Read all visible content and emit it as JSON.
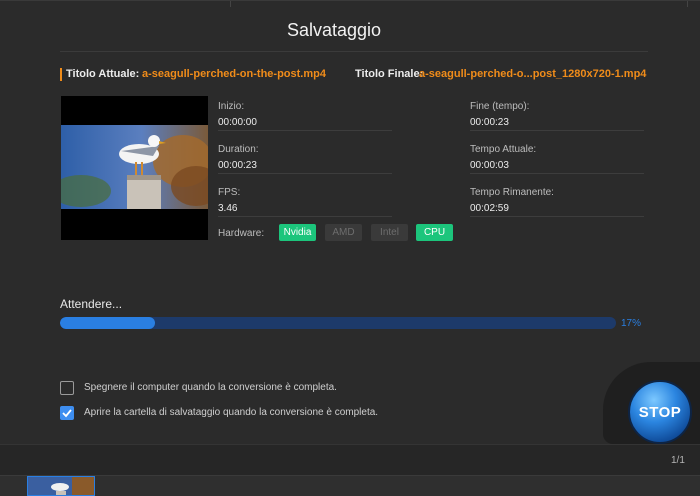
{
  "dialog": {
    "title": "Salvataggio"
  },
  "files": {
    "current_label": "Titolo Attuale:",
    "current_value": "a-seagull-perched-on-the-post.mp4",
    "final_label": "Titolo Finale:",
    "final_value": "a-seagull-perched-o...post_1280x720-1.mp4"
  },
  "stats": {
    "start_label": "Inizio:",
    "start_value": "00:00:00",
    "end_label": "Fine (tempo):",
    "end_value": "00:00:23",
    "duration_label": "Duration:",
    "duration_value": "00:00:23",
    "current_time_label": "Tempo Attuale:",
    "current_time_value": "00:00:03",
    "fps_label": "FPS:",
    "fps_value": "3.46",
    "remaining_label": "Tempo Rimanente:",
    "remaining_value": "00:02:59"
  },
  "hardware": {
    "label": "Hardware:",
    "chips": [
      {
        "label": "Nvidia",
        "active": true
      },
      {
        "label": "AMD",
        "active": false
      },
      {
        "label": "Intel",
        "active": false
      },
      {
        "label": "CPU",
        "active": true
      }
    ]
  },
  "progress": {
    "status": "Attendere...",
    "percent_text": "17%",
    "percent": 17
  },
  "options": {
    "shutdown_label": "Spegnere il computer quando la conversione è completa.",
    "shutdown_checked": false,
    "open_folder_label": "Aprire la cartella di salvataggio quando la conversione è completa.",
    "open_folder_checked": true
  },
  "stop_button": {
    "label": "STOP"
  },
  "footer": {
    "pager": "1/1"
  },
  "colors": {
    "accent_orange": "#f08c1a",
    "progress_blue": "#2a7fe2",
    "chip_green": "#1cc57c"
  }
}
